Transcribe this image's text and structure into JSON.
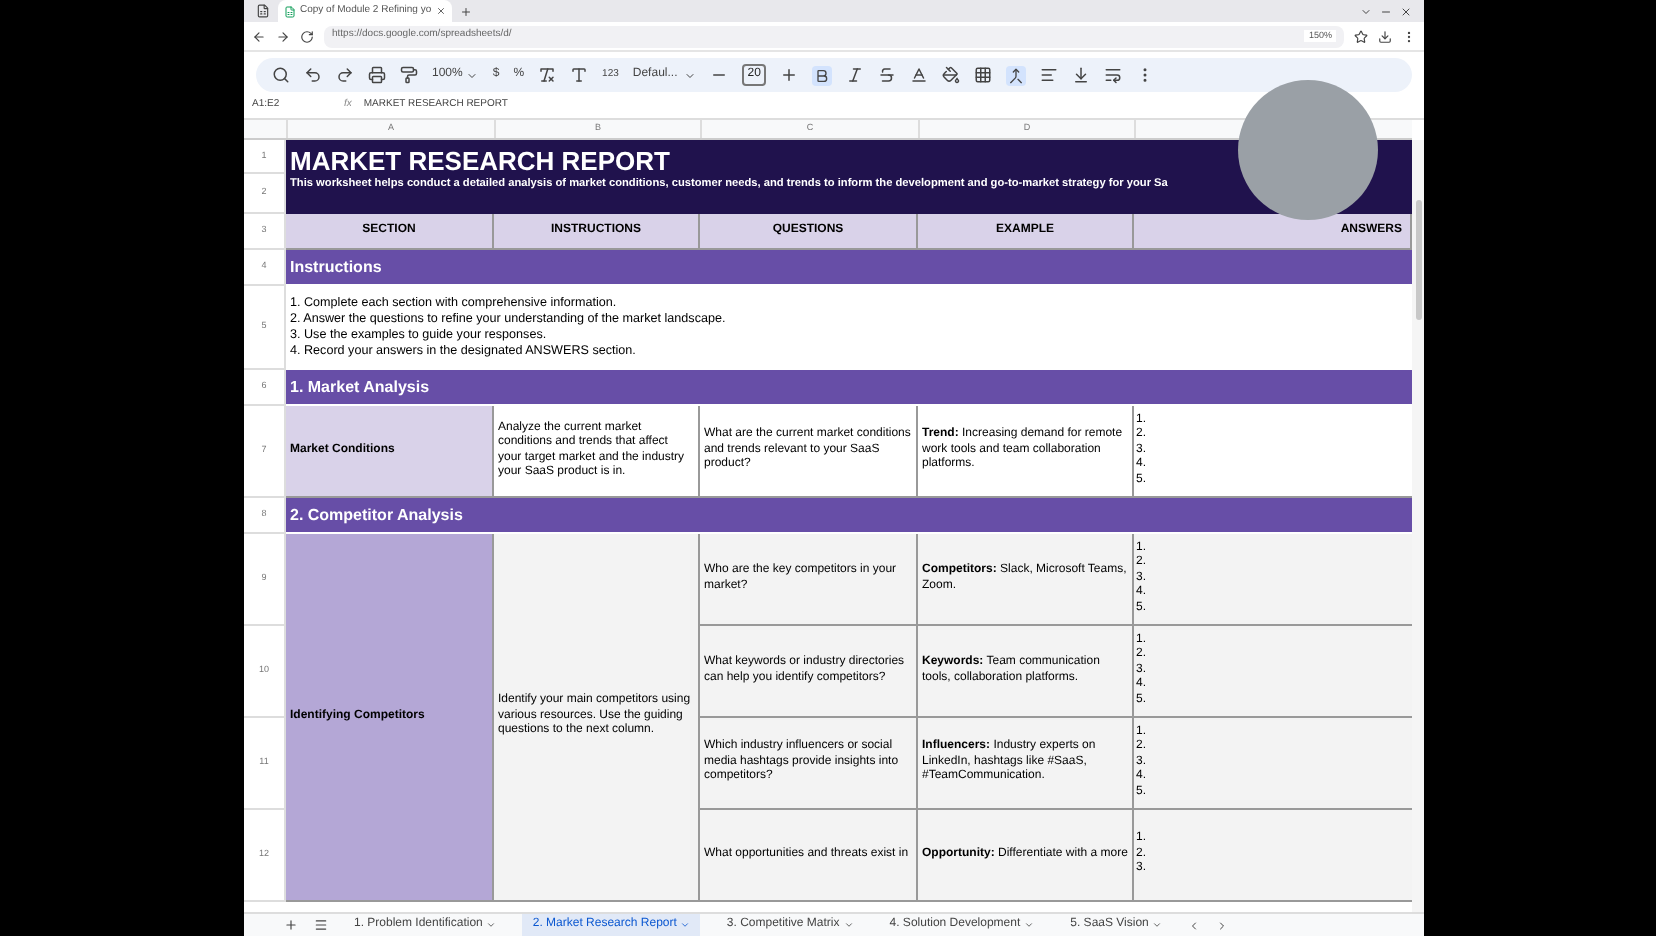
{
  "browser": {
    "tab_title": "Copy of Module 2 Refining yo",
    "url": "https://docs.google.com/spreadsheets/d/",
    "zoom": "150%"
  },
  "toolbar": {
    "zoom": "100%",
    "currency": "$",
    "percent": "%",
    "number_format": "123",
    "font": "Defaul...",
    "font_size": "20",
    "bold": true,
    "merge_active": true
  },
  "formula_bar": {
    "cell_ref": "A1:E2",
    "value": "MARKET RESEARCH REPORT"
  },
  "columns": [
    "A",
    "B",
    "C",
    "D"
  ],
  "row_numbers": [
    "1",
    "2",
    "3",
    "4",
    "5",
    "6",
    "7",
    "8",
    "9",
    "10",
    "11",
    "12"
  ],
  "fx_label": "fx",
  "title": "MARKET RESEARCH REPORT",
  "subtitle": "This worksheet helps conduct a detailed analysis of market conditions, customer needs, and trends to inform the development and go-to-market strategy for your Sa",
  "headers": [
    "SECTION",
    "INSTRUCTIONS",
    "QUESTIONS",
    "EXAMPLE",
    "ANSWERS"
  ],
  "sections": [
    {
      "kind": "instructions",
      "title": "Instructions",
      "lines": [
        "1. Complete each section with comprehensive information.",
        "2. Answer the questions to refine your understanding of the market landscape.",
        "3. Use the examples to guide your responses.",
        "4. Record your answers in the designated ANSWERS section."
      ]
    },
    {
      "kind": "topics",
      "title": "1. Market Analysis",
      "topics": [
        {
          "name": "Market Conditions",
          "shaded": false,
          "instructions": "Analyze the current market conditions and trends that affect your target market and the industry your SaaS product is in.",
          "questions": [
            {
              "question": "What are the current market conditions and trends relevant to your SaaS product?",
              "example_label": "Trend:",
              "example": "Increasing demand for remote work tools and team collaboration platforms.",
              "answers": [
                "1.",
                "2.",
                "3.",
                "4.",
                "5."
              ]
            }
          ]
        }
      ]
    },
    {
      "kind": "topics",
      "title": "2. Competitor Analysis",
      "topics": [
        {
          "name": "Identifying Competitors",
          "shaded": true,
          "instructions": "Identify your main competitors using various resources. Use the guiding questions to the next column.",
          "questions": [
            {
              "question": "Who are the key competitors in your market?",
              "example_label": "Competitors:",
              "example": "Slack, Microsoft Teams, Zoom.",
              "answers": [
                "1.",
                "2.",
                "3.",
                "4.",
                "5."
              ]
            },
            {
              "question": "What keywords or industry directories can help you identify competitors?",
              "example_label": "Keywords:",
              "example": "Team communication tools, collaboration platforms.",
              "answers": [
                "1.",
                "2.",
                "3.",
                "4.",
                "5."
              ]
            },
            {
              "question": "Which industry influencers or social media hashtags provide insights into competitors?",
              "example_label": "Influencers:",
              "example": "Industry experts on LinkedIn, hashtags like #SaaS, #TeamCommunication.",
              "answers": [
                "1.",
                "2.",
                "3.",
                "4.",
                "5."
              ]
            },
            {
              "question": "What opportunities and threats exist in",
              "example_label": "Opportunity:",
              "example": "Differentiate with a more",
              "answers": [
                "1.",
                "2.",
                "3."
              ]
            }
          ]
        }
      ]
    }
  ],
  "sheet_tabs": [
    {
      "label": "1. Problem Identification",
      "selected": false
    },
    {
      "label": "2. Market Research Report",
      "selected": true
    },
    {
      "label": "3. Competitive Matrix",
      "selected": false
    },
    {
      "label": "4. Solution Development",
      "selected": false
    },
    {
      "label": "5. SaaS Vision",
      "selected": false
    }
  ]
}
